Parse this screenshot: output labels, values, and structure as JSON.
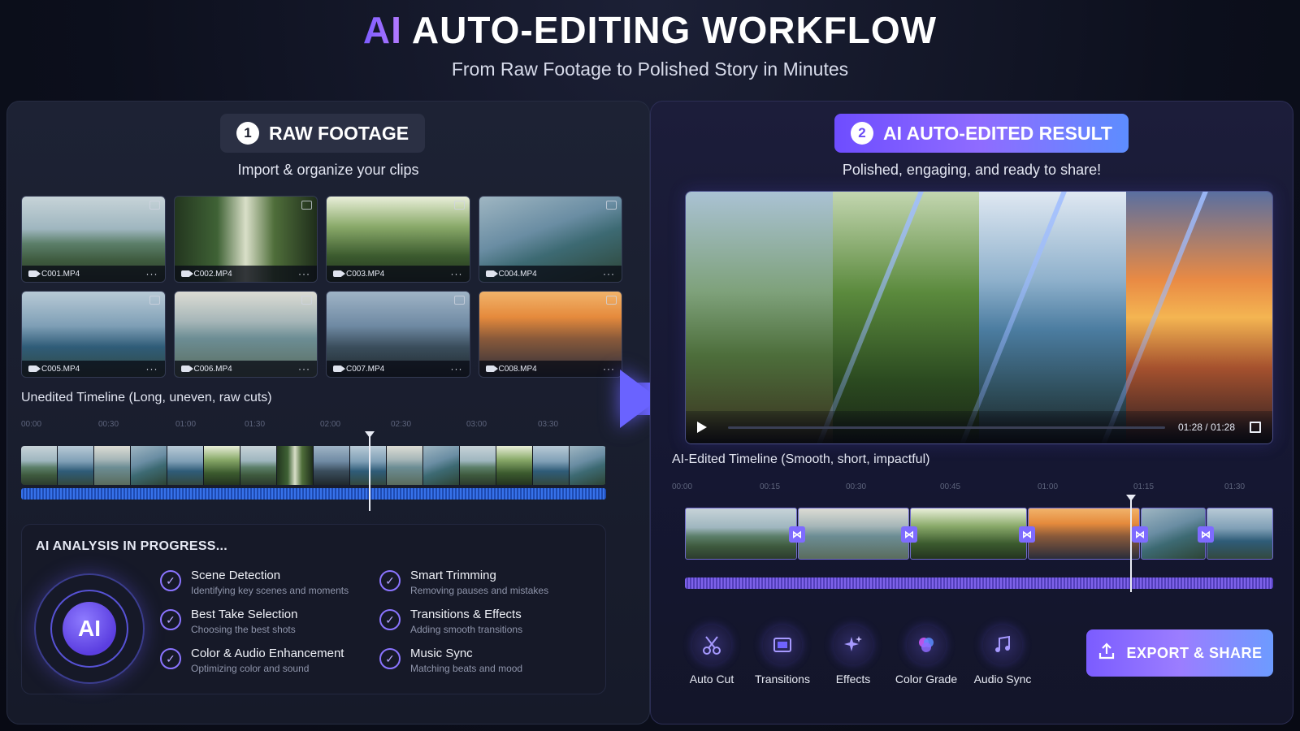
{
  "header": {
    "title_accent": "AI",
    "title_main": "AUTO-EDITING WORKFLOW",
    "subtitle": "From Raw Footage to Polished Story in Minutes"
  },
  "left_panel": {
    "step_number": "1",
    "step_title": "RAW FOOTAGE",
    "subtitle": "Import & organize your clips",
    "clips": [
      {
        "name": "C001.MP4"
      },
      {
        "name": "C002.MP4"
      },
      {
        "name": "C003.MP4"
      },
      {
        "name": "C004.MP4"
      },
      {
        "name": "C005.MP4"
      },
      {
        "name": "C006.MP4"
      },
      {
        "name": "C007.MP4"
      },
      {
        "name": "C008.MP4"
      }
    ],
    "more_glyph": "···",
    "timeline_label": "Unedited Timeline (Long, uneven, raw cuts)",
    "timeline_ticks": [
      "00:00",
      "00:30",
      "01:00",
      "01:30",
      "02:00",
      "02:30",
      "03:00",
      "03:30"
    ],
    "analysis": {
      "title": "AI ANALYSIS IN PROGRESS...",
      "badge": "AI",
      "features": [
        {
          "title": "Scene Detection",
          "desc": "Identifying key scenes and moments"
        },
        {
          "title": "Smart Trimming",
          "desc": "Removing pauses and mistakes"
        },
        {
          "title": "Best Take Selection",
          "desc": "Choosing the best shots"
        },
        {
          "title": "Transitions & Effects",
          "desc": "Adding smooth transitions"
        },
        {
          "title": "Color & Audio Enhancement",
          "desc": "Optimizing color and sound"
        },
        {
          "title": "Music Sync",
          "desc": "Matching beats and mood"
        }
      ]
    }
  },
  "right_panel": {
    "step_number": "2",
    "step_title": "AI AUTO-EDITED RESULT",
    "subtitle": "Polished, engaging, and ready to share!",
    "player": {
      "time": "01:28 / 01:28"
    },
    "timeline_label": "AI-Edited Timeline (Smooth, short, impactful)",
    "timeline_ticks": [
      "00:00",
      "00:15",
      "00:30",
      "00:45",
      "01:00",
      "01:15",
      "01:30"
    ],
    "transition_glyph": "⋈",
    "tools": [
      {
        "label": "Auto Cut",
        "icon": "scissors-icon"
      },
      {
        "label": "Transitions",
        "icon": "transitions-icon"
      },
      {
        "label": "Effects",
        "icon": "sparkle-icon"
      },
      {
        "label": "Color Grade",
        "icon": "color-grade-icon"
      },
      {
        "label": "Audio Sync",
        "icon": "music-note-icon"
      }
    ],
    "export_label": "EXPORT & SHARE"
  },
  "colors": {
    "accent": "#7c5cff",
    "accent_blue": "#6d9bff",
    "background": "#0c0f1c"
  }
}
